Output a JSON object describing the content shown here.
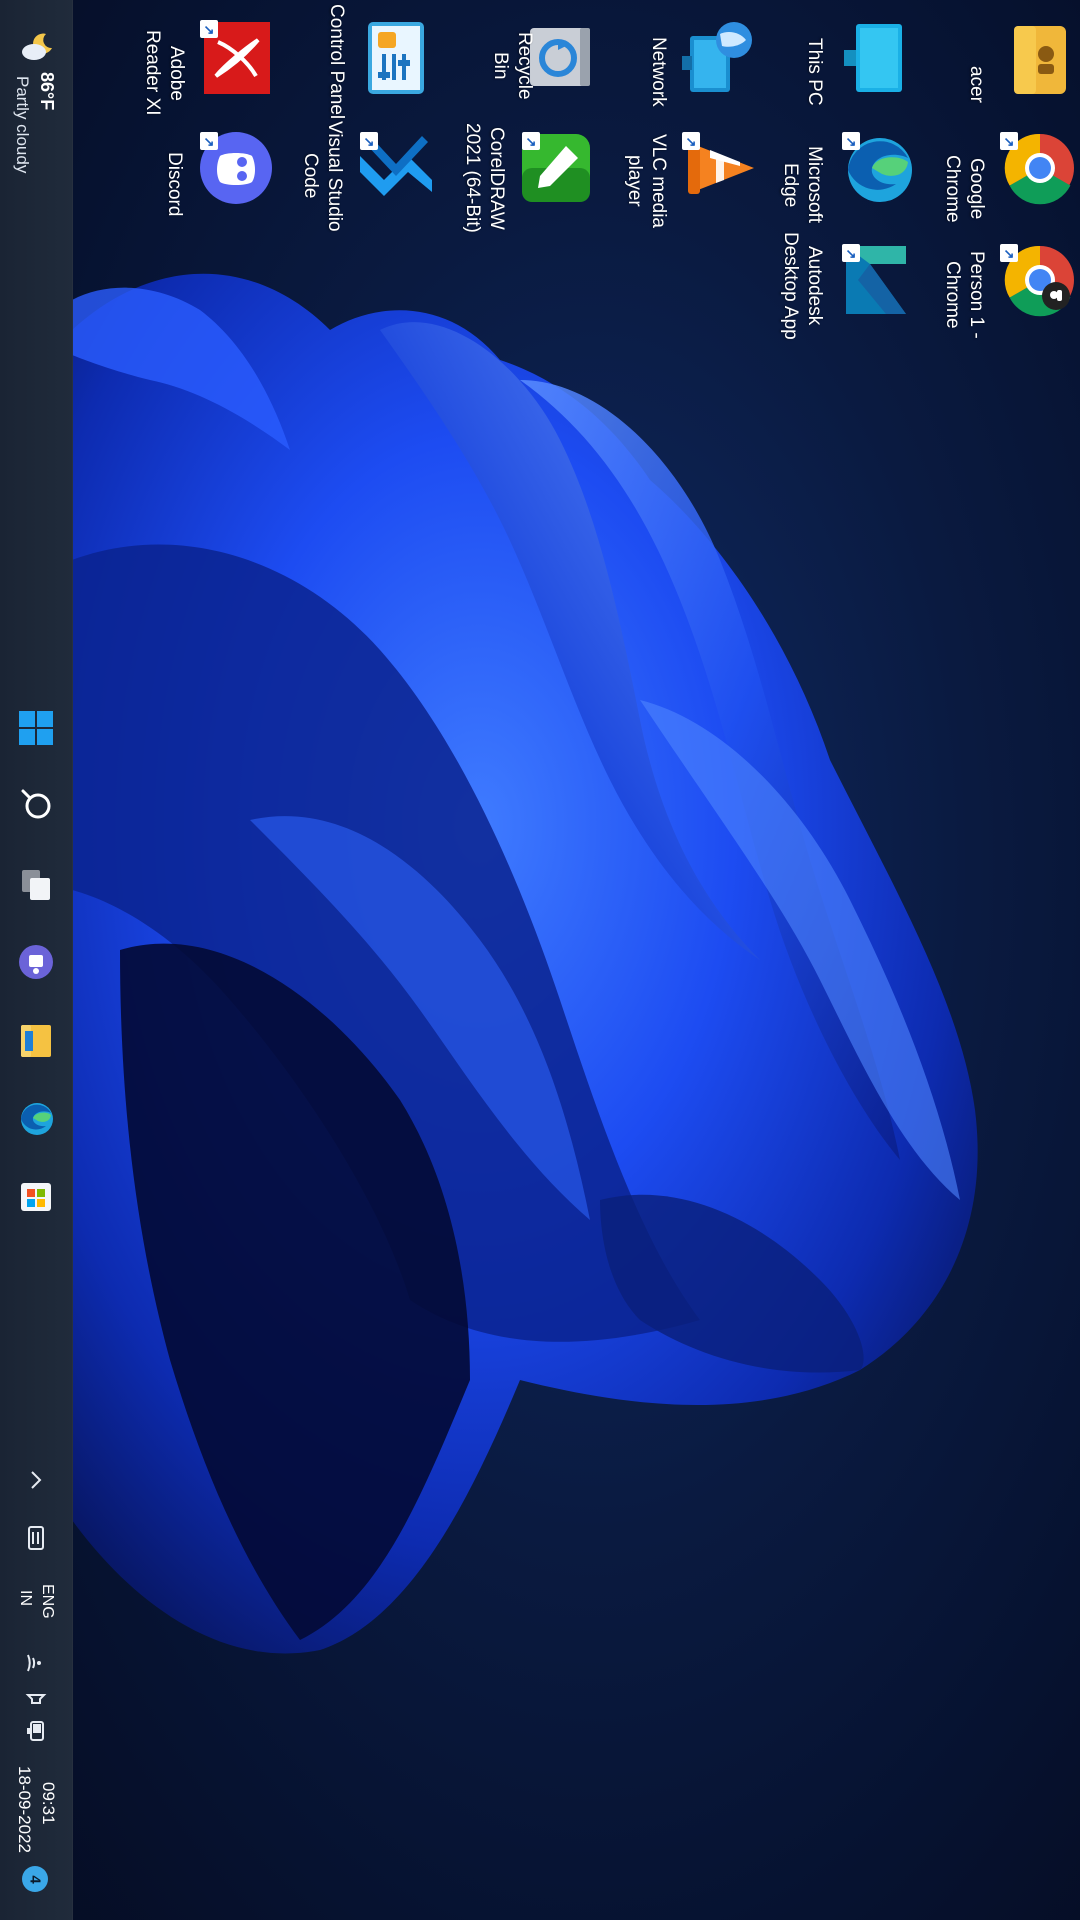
{
  "desktop": {
    "icons": [
      {
        "label": "acer",
        "icon": "folder-icon"
      },
      {
        "label": "Google\nChrome",
        "icon": "chrome-icon",
        "shortcut": true
      },
      {
        "label": "Person 1 -\nChrome",
        "icon": "chrome-profile-icon",
        "shortcut": true
      },
      {
        "label": "This PC",
        "icon": "monitor-icon"
      },
      {
        "label": "Microsoft\nEdge",
        "icon": "edge-icon",
        "shortcut": true
      },
      {
        "label": "Autodesk\nDesktop App",
        "icon": "autodesk-icon",
        "shortcut": true
      },
      {
        "label": "Network",
        "icon": "network-icon"
      },
      {
        "label": "VLC media\nplayer",
        "icon": "vlc-icon",
        "shortcut": true
      },
      {
        "label": "Recycle Bin",
        "icon": "recycle-bin-icon"
      },
      {
        "label": "CorelDRAW\n2021 (64-Bit)",
        "icon": "coreldraw-icon",
        "shortcut": true
      },
      {
        "label": "Control Panel",
        "icon": "control-panel-icon"
      },
      {
        "label": "Visual Studio\nCode",
        "icon": "vscode-icon",
        "shortcut": true
      },
      {
        "label": "Adobe\nReader XI",
        "icon": "adobe-reader-icon",
        "shortcut": true
      },
      {
        "label": "Discord",
        "icon": "discord-icon",
        "shortcut": true
      }
    ]
  },
  "taskbar": {
    "weather": {
      "temp": "86°F",
      "condition": "Partly cloudy",
      "icon": "weather-moon-cloud-icon"
    },
    "pinned": [
      {
        "name": "start",
        "icon": "windows-start-icon"
      },
      {
        "name": "search",
        "icon": "search-icon"
      },
      {
        "name": "task-view",
        "icon": "task-view-icon"
      },
      {
        "name": "teams-chat",
        "icon": "teams-chat-icon"
      },
      {
        "name": "file-explorer",
        "icon": "file-explorer-icon"
      },
      {
        "name": "edge",
        "icon": "edge-icon"
      },
      {
        "name": "store",
        "icon": "microsoft-store-icon"
      }
    ],
    "tray": {
      "language_top": "ENG",
      "language_bottom": "IN",
      "time": "09:31",
      "date": "18-09-2022",
      "notification_count": "4"
    }
  },
  "colors": {
    "taskbar": "#1d2736",
    "wallpaper_blue": "#1a4bf0",
    "notification_badge": "#3aa7e8"
  }
}
